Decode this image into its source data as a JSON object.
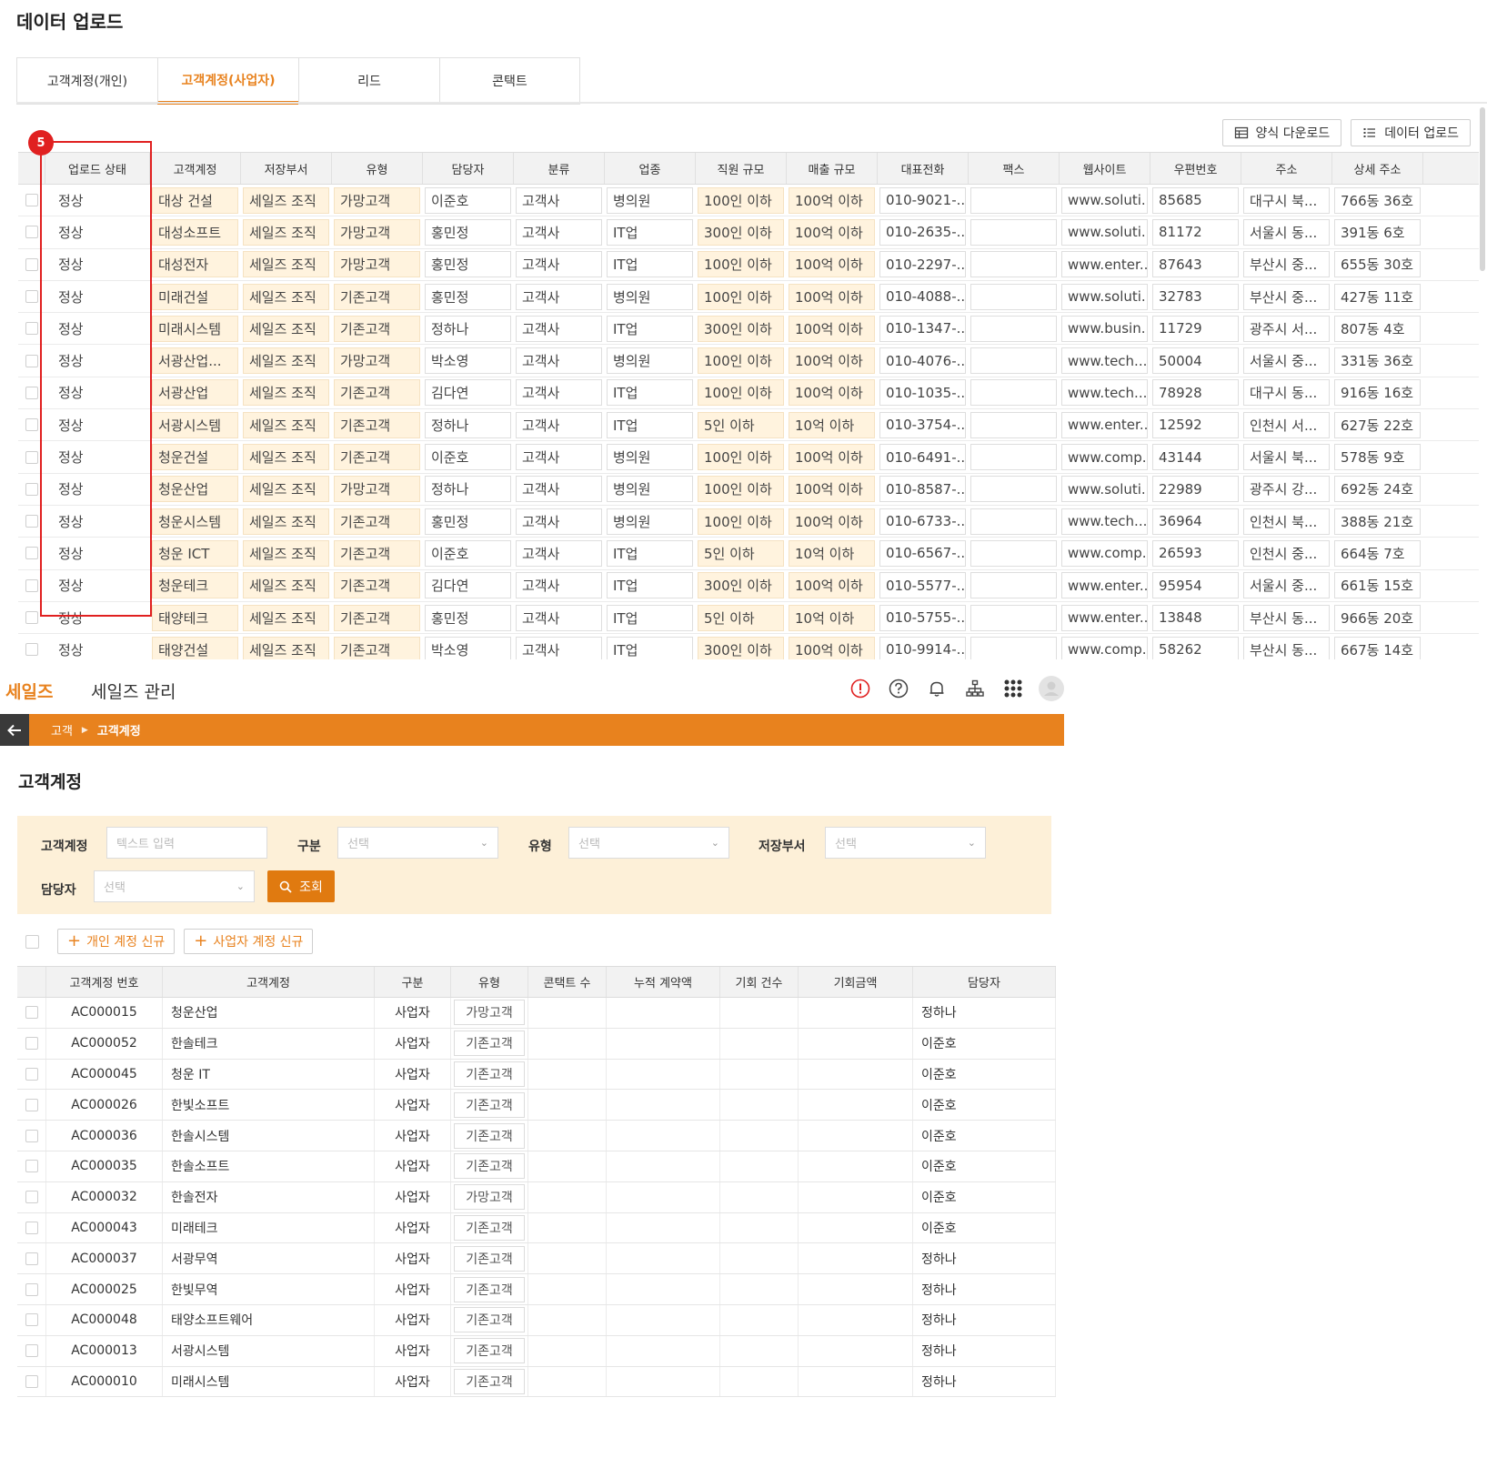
{
  "upload": {
    "title": "데이터 업로드",
    "tabs": [
      "고객계정(개인)",
      "고객계정(사업자)",
      "리드",
      "콘택트"
    ],
    "active_tab": 1,
    "buttons": {
      "template_download": "양식 다운로드",
      "data_upload": "데이터 업로드"
    },
    "annotation_badge": "5",
    "columns": [
      "업로드 상태",
      "고객계정",
      "저장부서",
      "유형",
      "담당자",
      "분류",
      "업종",
      "직원 규모",
      "매출 규모",
      "대표전화",
      "팩스",
      "웹사이트",
      "우편번호",
      "주소",
      "상세 주소"
    ],
    "rows": [
      [
        "정상",
        "대상 건설",
        "세일즈 조직",
        "가망고객",
        "이준호",
        "고객사",
        "병의원",
        "100인 이하",
        "100억 이하",
        "010-9021-...",
        "",
        "www.soluti...",
        "85685",
        "대구시 북...",
        "766동 36호"
      ],
      [
        "정상",
        "대성소프트",
        "세일즈 조직",
        "가망고객",
        "홍민정",
        "고객사",
        "IT업",
        "300인 이하",
        "100억 이하",
        "010-2635-...",
        "",
        "www.soluti...",
        "81172",
        "서울시 동...",
        "391동 6호"
      ],
      [
        "정상",
        "대성전자",
        "세일즈 조직",
        "가망고객",
        "홍민정",
        "고객사",
        "IT업",
        "100인 이하",
        "100억 이하",
        "010-2297-...",
        "",
        "www.enter...",
        "87643",
        "부산시 중...",
        "655동 30호"
      ],
      [
        "정상",
        "미래건설",
        "세일즈 조직",
        "기존고객",
        "홍민정",
        "고객사",
        "병의원",
        "100인 이하",
        "100억 이하",
        "010-4088-...",
        "",
        "www.soluti...",
        "32783",
        "부산시 중...",
        "427동 11호"
      ],
      [
        "정상",
        "미래시스템",
        "세일즈 조직",
        "기존고객",
        "정하나",
        "고객사",
        "IT업",
        "300인 이하",
        "100억 이하",
        "010-1347-...",
        "",
        "www.busin...",
        "11729",
        "광주시 서...",
        "807동 4호"
      ],
      [
        "정상",
        "서광산업...",
        "세일즈 조직",
        "가망고객",
        "박소영",
        "고객사",
        "병의원",
        "100인 이하",
        "100억 이하",
        "010-4076-...",
        "",
        "www.tech....",
        "50004",
        "서울시 중...",
        "331동 36호"
      ],
      [
        "정상",
        "서광산업",
        "세일즈 조직",
        "기존고객",
        "김다연",
        "고객사",
        "IT업",
        "100인 이하",
        "100억 이하",
        "010-1035-...",
        "",
        "www.tech....",
        "78928",
        "대구시 동...",
        "916동 16호"
      ],
      [
        "정상",
        "서광시스템",
        "세일즈 조직",
        "기존고객",
        "정하나",
        "고객사",
        "IT업",
        "5인 이하",
        "10억 이하",
        "010-3754-...",
        "",
        "www.enter...",
        "12592",
        "인천시 서...",
        "627동 22호"
      ],
      [
        "정상",
        "청운건설",
        "세일즈 조직",
        "기존고객",
        "이준호",
        "고객사",
        "병의원",
        "100인 이하",
        "100억 이하",
        "010-6491-...",
        "",
        "www.comp...",
        "43144",
        "서울시 북...",
        "578동 9호"
      ],
      [
        "정상",
        "청운산업",
        "세일즈 조직",
        "가망고객",
        "정하나",
        "고객사",
        "병의원",
        "100인 이하",
        "100억 이하",
        "010-8587-...",
        "",
        "www.soluti...",
        "22989",
        "광주시 강...",
        "692동 24호"
      ],
      [
        "정상",
        "청운시스템",
        "세일즈 조직",
        "기존고객",
        "홍민정",
        "고객사",
        "병의원",
        "100인 이하",
        "100억 이하",
        "010-6733-...",
        "",
        "www.tech....",
        "36964",
        "인천시 북...",
        "388동 21호"
      ],
      [
        "정상",
        "청운 ICT",
        "세일즈 조직",
        "기존고객",
        "이준호",
        "고객사",
        "IT업",
        "5인 이하",
        "10억 이하",
        "010-6567-...",
        "",
        "www.comp...",
        "26593",
        "인천시 중...",
        "664동 7호"
      ],
      [
        "정상",
        "청운테크",
        "세일즈 조직",
        "기존고객",
        "김다연",
        "고객사",
        "IT업",
        "300인 이하",
        "100억 이하",
        "010-5577-...",
        "",
        "www.enter...",
        "95954",
        "서울시 중...",
        "661동 15호"
      ],
      [
        "정상",
        "태양테크",
        "세일즈 조직",
        "기존고객",
        "홍민정",
        "고객사",
        "IT업",
        "5인 이하",
        "10억 이하",
        "010-5755-...",
        "",
        "www.enter...",
        "13848",
        "부산시 동...",
        "966동 20호"
      ],
      [
        "정상",
        "태양건설",
        "세일즈 조직",
        "기존고객",
        "박소영",
        "고객사",
        "IT업",
        "300인 이하",
        "100억 이하",
        "010-9914-...",
        "",
        "www.comp...",
        "58262",
        "부산시 동...",
        "667동 14호"
      ]
    ]
  },
  "app": {
    "brand": "세일즈",
    "app_name": "세일즈 관리",
    "breadcrumb": {
      "parent": "고객",
      "current": "고객계정"
    },
    "page_title": "고객계정",
    "filters": {
      "account_label": "고객계정",
      "account_placeholder": "텍스트 입력",
      "division_label": "구분",
      "type_label": "유형",
      "dept_label": "저장부서",
      "manager_label": "담당자",
      "select_placeholder": "선택",
      "search_label": "조회"
    },
    "actions": {
      "new_personal": "개인 계정 신규",
      "new_business": "사업자 계정 신규"
    },
    "columns": [
      "고객계정 번호",
      "고객계정",
      "구분",
      "유형",
      "콘택트 수",
      "누적 계약액",
      "기회 건수",
      "기회금액",
      "담당자"
    ],
    "rows": [
      [
        "AC000015",
        "청운산업",
        "사업자",
        "가망고객",
        "정하나"
      ],
      [
        "AC000052",
        "한솔테크",
        "사업자",
        "기존고객",
        "이준호"
      ],
      [
        "AC000045",
        "청운 IT",
        "사업자",
        "기존고객",
        "이준호"
      ],
      [
        "AC000026",
        "한빛소프트",
        "사업자",
        "기존고객",
        "이준호"
      ],
      [
        "AC000036",
        "한솔시스템",
        "사업자",
        "기존고객",
        "이준호"
      ],
      [
        "AC000035",
        "한솔소프트",
        "사업자",
        "기존고객",
        "이준호"
      ],
      [
        "AC000032",
        "한솔전자",
        "사업자",
        "가망고객",
        "이준호"
      ],
      [
        "AC000043",
        "미래테크",
        "사업자",
        "기존고객",
        "이준호"
      ],
      [
        "AC000037",
        "서광무역",
        "사업자",
        "기존고객",
        "정하나"
      ],
      [
        "AC000025",
        "한빛무역",
        "사업자",
        "기존고객",
        "정하나"
      ],
      [
        "AC000048",
        "태양소프트웨어",
        "사업자",
        "기존고객",
        "정하나"
      ],
      [
        "AC000013",
        "서광시스템",
        "사업자",
        "기존고객",
        "정하나"
      ],
      [
        "AC000010",
        "미래시스템",
        "사업자",
        "기존고객",
        "정하나"
      ]
    ]
  },
  "colors": {
    "accent": "#e8821e",
    "annotation": "#e02020",
    "filter_bg": "#fdf0d8",
    "highlight_cell": "#fff3de"
  },
  "icons": [
    "grid-icon",
    "list-icon",
    "alert-icon",
    "help-icon",
    "bell-icon",
    "org-chart-icon",
    "apps-grid-icon",
    "avatar-icon",
    "back-arrow-icon",
    "search-icon",
    "plus-icon",
    "chevron-down-icon"
  ]
}
